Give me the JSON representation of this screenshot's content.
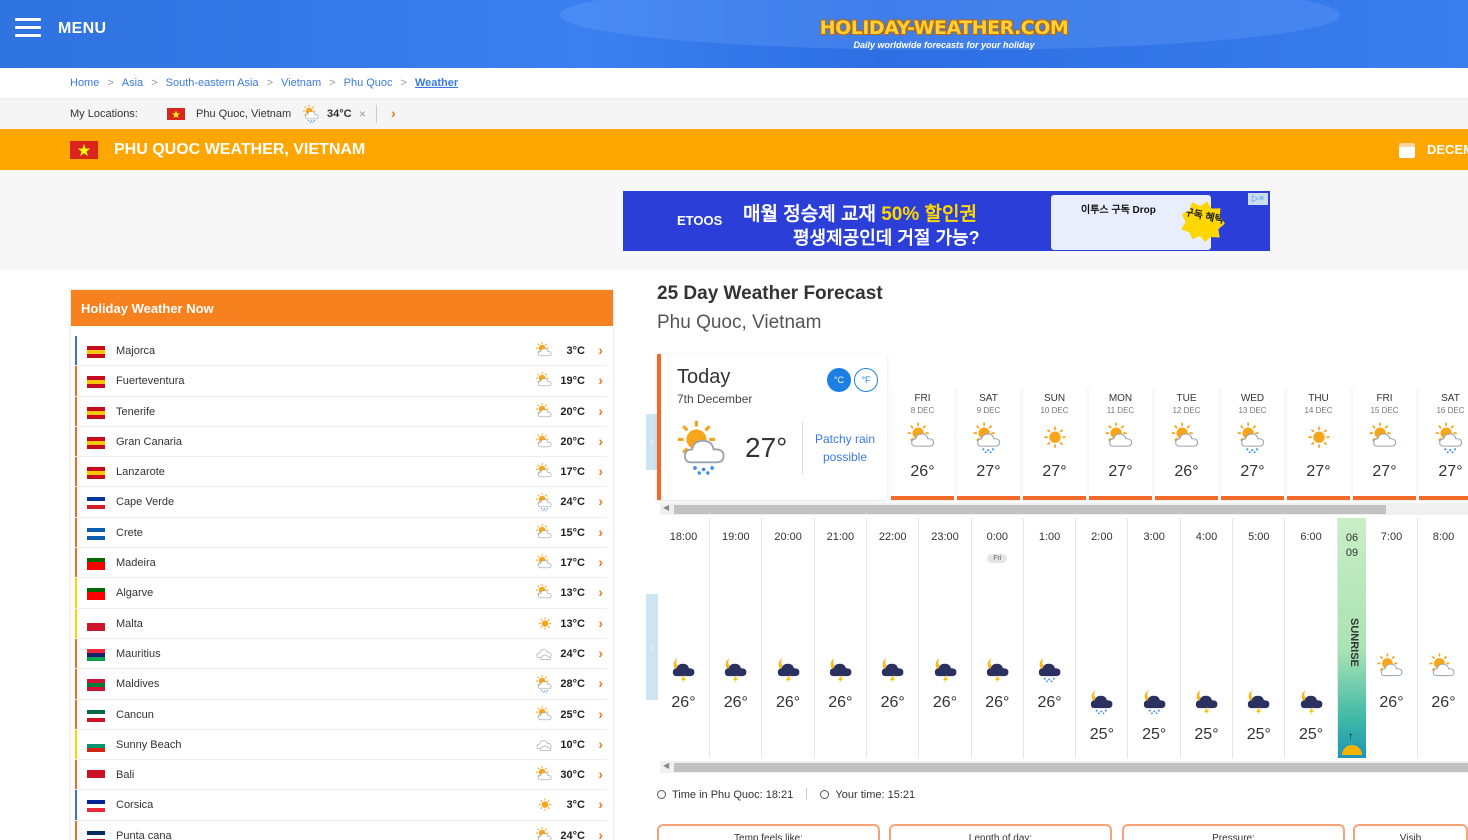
{
  "header": {
    "menu_label": "MENU",
    "logo_text": "HOLIDAY-WEATHER.COM",
    "logo_tagline": "Daily worldwide forecasts for your holiday"
  },
  "breadcrumbs": [
    "Home",
    "Asia",
    "South-eastern Asia",
    "Vietnam",
    "Phu Quoc",
    "Weather"
  ],
  "my_locations": {
    "label": "My Locations:",
    "location": "Phu Quoc, Vietnam",
    "temp": "34°C",
    "remove": "×",
    "next": "›"
  },
  "title_bar": {
    "title": "PHU QUOC WEATHER, VIETNAM",
    "month": "DECEM"
  },
  "ad": {
    "brand": "ETOOS",
    "line1_a": "매월 ",
    "line1_b": "정승제 교재 ",
    "line1_c": "50% 할인권",
    "line2": "평생제공인데 거절 가능?",
    "box_title": "이투스 구독 Drop",
    "badge": "구독 혜택",
    "close": "▷×"
  },
  "panel": {
    "title": "Holiday Weather Now",
    "rows": [
      {
        "name": "Majorca",
        "temp": "3°C",
        "flag": [
          "#c60b1e",
          "#ffc400",
          "#c60b1e"
        ],
        "bar": "#2f73e0",
        "icon": "sun-cloud"
      },
      {
        "name": "Fuerteventura",
        "temp": "19°C",
        "flag": [
          "#c60b1e",
          "#ffc400",
          "#c60b1e"
        ],
        "bar": "#f26a2b",
        "icon": "sun-cloud"
      },
      {
        "name": "Tenerife",
        "temp": "20°C",
        "flag": [
          "#c60b1e",
          "#ffc400",
          "#c60b1e"
        ],
        "bar": "#f26a2b",
        "icon": "sun-cloud"
      },
      {
        "name": "Gran Canaria",
        "temp": "20°C",
        "flag": [
          "#c60b1e",
          "#ffc400",
          "#c60b1e"
        ],
        "bar": "#f26a2b",
        "icon": "sun-cloud"
      },
      {
        "name": "Lanzarote",
        "temp": "17°C",
        "flag": [
          "#c60b1e",
          "#ffc400",
          "#c60b1e"
        ],
        "bar": "#f26a2b",
        "icon": "sun-cloud"
      },
      {
        "name": "Cape Verde",
        "temp": "24°C",
        "flag": [
          "#003893",
          "#ffffff",
          "#cf2027"
        ],
        "bar": "#f26a2b",
        "icon": "sun-cloud-rain"
      },
      {
        "name": "Crete",
        "temp": "15°C",
        "flag": [
          "#0d5eaf",
          "#ffffff",
          "#0d5eaf"
        ],
        "bar": "#f26a2b",
        "icon": "sun-cloud"
      },
      {
        "name": "Madeira",
        "temp": "17°C",
        "flag": [
          "#006600",
          "#ff0000",
          "#ff0000"
        ],
        "bar": "#f26a2b",
        "icon": "sun-cloud"
      },
      {
        "name": "Algarve",
        "temp": "13°C",
        "flag": [
          "#006600",
          "#ff0000",
          "#ff0000"
        ],
        "bar": "#ffd200",
        "icon": "sun-cloud"
      },
      {
        "name": "Malta",
        "temp": "13°C",
        "flag": [
          "#ffffff",
          "#cf142b",
          "#cf142b"
        ],
        "bar": "#ffd200",
        "icon": "sun"
      },
      {
        "name": "Mauritius",
        "temp": "24°C",
        "flag": [
          "#ea2839",
          "#1a206d",
          "#00a551"
        ],
        "bar": "#f26a2b",
        "icon": "cloud"
      },
      {
        "name": "Maldives",
        "temp": "28°C",
        "flag": [
          "#d21034",
          "#007e3a",
          "#d21034"
        ],
        "bar": "#f26a2b",
        "icon": "sun-cloud-rain"
      },
      {
        "name": "Cancun",
        "temp": "25°C",
        "flag": [
          "#006847",
          "#ffffff",
          "#ce1126"
        ],
        "bar": "#f26a2b",
        "icon": "sun-cloud"
      },
      {
        "name": "Sunny Beach",
        "temp": "10°C",
        "flag": [
          "#ffffff",
          "#00966e",
          "#d62612"
        ],
        "bar": "#ffd200",
        "icon": "cloud"
      },
      {
        "name": "Bali",
        "temp": "30°C",
        "flag": [
          "#ce1126",
          "#ce1126",
          "#ffffff"
        ],
        "bar": "#f26a2b",
        "icon": "sun-cloud"
      },
      {
        "name": "Corsica",
        "temp": "3°C",
        "flag": [
          "#002395",
          "#ffffff",
          "#ed2939"
        ],
        "bar": "#2f73e0",
        "icon": "sun"
      },
      {
        "name": "Punta cana",
        "temp": "24°C",
        "flag": [
          "#002d62",
          "#ffffff",
          "#ce1126"
        ],
        "bar": "#f26a2b",
        "icon": "sun-cloud"
      }
    ]
  },
  "forecast": {
    "title": "25 Day Weather Forecast",
    "subtitle": "Phu Quoc, Vietnam",
    "today": {
      "label": "Today",
      "date": "7th December",
      "temp": "27°",
      "desc": "Patchy rain possible",
      "unit_c": "°C",
      "unit_f": "°F"
    },
    "days": [
      {
        "day": "FRI",
        "date": "8 DEC",
        "temp": "26°",
        "icon": "sun-cloud"
      },
      {
        "day": "SAT",
        "date": "9 DEC",
        "temp": "27°",
        "icon": "sun-cloud-rain"
      },
      {
        "day": "SUN",
        "date": "10 DEC",
        "temp": "27°",
        "icon": "sun"
      },
      {
        "day": "MON",
        "date": "11 DEC",
        "temp": "27°",
        "icon": "sun-cloud"
      },
      {
        "day": "TUE",
        "date": "12 DEC",
        "temp": "26°",
        "icon": "sun-cloud"
      },
      {
        "day": "WED",
        "date": "13 DEC",
        "temp": "27°",
        "icon": "sun-cloud-rain"
      },
      {
        "day": "THU",
        "date": "14 DEC",
        "temp": "27°",
        "icon": "sun"
      },
      {
        "day": "FRI",
        "date": "15 DEC",
        "temp": "27°",
        "icon": "sun-cloud"
      },
      {
        "day": "SAT",
        "date": "16 DEC",
        "temp": "27°",
        "icon": "sun-cloud-rain"
      }
    ],
    "hours": [
      {
        "time": "18:00",
        "temp": "26°",
        "icon": "night-storm"
      },
      {
        "time": "19:00",
        "temp": "26°",
        "icon": "night-storm"
      },
      {
        "time": "20:00",
        "temp": "26°",
        "icon": "night-storm"
      },
      {
        "time": "21:00",
        "temp": "26°",
        "icon": "night-storm"
      },
      {
        "time": "22:00",
        "temp": "26°",
        "icon": "night-storm"
      },
      {
        "time": "23:00",
        "temp": "26°",
        "icon": "night-storm"
      },
      {
        "time": "0:00",
        "temp": "26°",
        "icon": "night-storm",
        "pill": "Fri"
      },
      {
        "time": "1:00",
        "temp": "26°",
        "icon": "night-rain"
      },
      {
        "time": "2:00",
        "temp": "25°",
        "icon": "night-rain"
      },
      {
        "time": "3:00",
        "temp": "25°",
        "icon": "night-rain"
      },
      {
        "time": "4:00",
        "temp": "25°",
        "icon": "night-storm"
      },
      {
        "time": "5:00",
        "temp": "25°",
        "icon": "night-storm"
      },
      {
        "time": "6:00",
        "temp": "25°",
        "icon": "night-storm"
      },
      {
        "time": "7:00",
        "temp": "26°",
        "icon": "sun-cloud"
      },
      {
        "time": "8:00",
        "temp": "26°",
        "icon": "sun-cloud"
      }
    ],
    "sunrise": {
      "h": "06",
      "m": "09",
      "label": "SUNRISE"
    },
    "time_in_label": "Time in Phu Quoc:",
    "time_in": "18:21",
    "your_time_label": "Your time:",
    "your_time": "15:21",
    "cards": [
      "Temp feels like:",
      "Length of day:",
      "Pressure:",
      "Visib"
    ]
  },
  "colors": {
    "accent_orange": "#f26a2b",
    "title_bar": "#ffa600",
    "header_blue": "#2f73e0",
    "link": "#3a7ae0"
  }
}
